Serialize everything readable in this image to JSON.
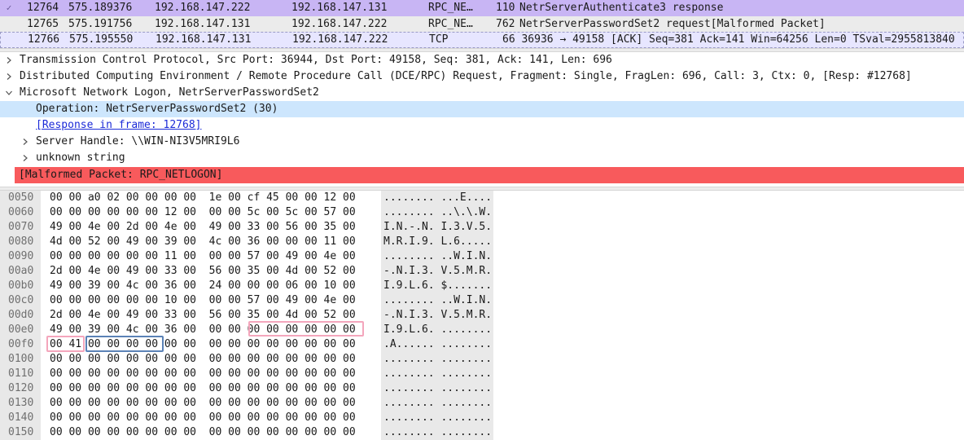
{
  "packet_list": {
    "rows": [
      {
        "no": "12764",
        "time": "575.189376",
        "src": "192.168.147.222",
        "dst": "192.168.147.131",
        "proto": "RPC_NETLOGON",
        "length": "110",
        "info": "NetrServerAuthenticate3 response"
      },
      {
        "no": "12765",
        "time": "575.191756",
        "src": "192.168.147.131",
        "dst": "192.168.147.222",
        "proto": "RPC_NETLOGON",
        "length": "762",
        "info": "NetrServerPasswordSet2 request[Malformed Packet]"
      },
      {
        "no": "12766",
        "time": "575.195550",
        "src": "192.168.147.131",
        "dst": "192.168.147.222",
        "proto": "TCP",
        "length": "",
        "info": "66 36936 → 49158 [ACK] Seq=381 Ack=141 Win=64256 Len=0 TSval=2955813840"
      }
    ]
  },
  "detail_tree": {
    "tcp": "Transmission Control Protocol, Src Port: 36944, Dst Port: 49158, Seq: 381, Ack: 141, Len: 696",
    "dcerpc": "Distributed Computing Environment / Remote Procedure Call (DCE/RPC) Request, Fragment: Single, FragLen: 696, Call: 3, Ctx: 0, [Resp: #12768]",
    "netlogon": "Microsoft Network Logon, NetrServerPasswordSet2",
    "operation": "Operation: NetrServerPasswordSet2 (30)",
    "response_link": "[Response in frame: 12768]",
    "server_handle": "Server Handle: \\\\WIN-NI3V5MRI9L6",
    "unknown_string": "unknown string",
    "malformed": "[Malformed Packet: RPC_NETLOGON]"
  },
  "hex_dump": {
    "rows": [
      {
        "offset": "0050",
        "bytes": "00 00 a0 02 00 00 00 00  1e 00 cf 45 00 00 12 00",
        "ascii": "........ ...E...."
      },
      {
        "offset": "0060",
        "bytes": "00 00 00 00 00 00 12 00  00 00 5c 00 5c 00 57 00",
        "ascii": "........ ..\\.\\.W."
      },
      {
        "offset": "0070",
        "bytes": "49 00 4e 00 2d 00 4e 00  49 00 33 00 56 00 35 00",
        "ascii": "I.N.-.N. I.3.V.5."
      },
      {
        "offset": "0080",
        "bytes": "4d 00 52 00 49 00 39 00  4c 00 36 00 00 00 11 00",
        "ascii": "M.R.I.9. L.6....."
      },
      {
        "offset": "0090",
        "bytes": "00 00 00 00 00 00 11 00  00 00 57 00 49 00 4e 00",
        "ascii": "........ ..W.I.N."
      },
      {
        "offset": "00a0",
        "bytes": "2d 00 4e 00 49 00 33 00  56 00 35 00 4d 00 52 00",
        "ascii": "-.N.I.3. V.5.M.R."
      },
      {
        "offset": "00b0",
        "bytes": "49 00 39 00 4c 00 36 00  24 00 00 00 06 00 10 00",
        "ascii": "I.9.L.6. $......."
      },
      {
        "offset": "00c0",
        "bytes": "00 00 00 00 00 00 10 00  00 00 57 00 49 00 4e 00",
        "ascii": "........ ..W.I.N."
      },
      {
        "offset": "00d0",
        "bytes": "2d 00 4e 00 49 00 33 00  56 00 35 00 4d 00 52 00",
        "ascii": "-.N.I.3. V.5.M.R."
      },
      {
        "offset": "00e0",
        "bytes": "49 00 39 00 4c 00 36 00  00 00 00 00 00 00 00 00",
        "ascii": "I.9.L.6. ........"
      },
      {
        "offset": "00f0",
        "bytes": "00 41 00 00 00 00 00 00  00 00 00 00 00 00 00 00",
        "ascii": ".A...... ........"
      },
      {
        "offset": "0100",
        "bytes": "00 00 00 00 00 00 00 00  00 00 00 00 00 00 00 00",
        "ascii": "........ ........"
      },
      {
        "offset": "0110",
        "bytes": "00 00 00 00 00 00 00 00  00 00 00 00 00 00 00 00",
        "ascii": "........ ........"
      },
      {
        "offset": "0120",
        "bytes": "00 00 00 00 00 00 00 00  00 00 00 00 00 00 00 00",
        "ascii": "........ ........"
      },
      {
        "offset": "0130",
        "bytes": "00 00 00 00 00 00 00 00  00 00 00 00 00 00 00 00",
        "ascii": "........ ........"
      },
      {
        "offset": "0140",
        "bytes": "00 00 00 00 00 00 00 00  00 00 00 00 00 00 00 00",
        "ascii": "........ ........"
      },
      {
        "offset": "0150",
        "bytes": "00 00 00 00 00 00 00 00  00 00 00 00 00 00 00 00",
        "ascii": "........ ........"
      }
    ]
  },
  "colors": {
    "selected_packet": "#c8b5f4",
    "malformed": "#f85a5c",
    "highlight_field": "#cde6fd",
    "marker_pink": "#f4a6bc",
    "marker_blue": "#5b82b6"
  }
}
